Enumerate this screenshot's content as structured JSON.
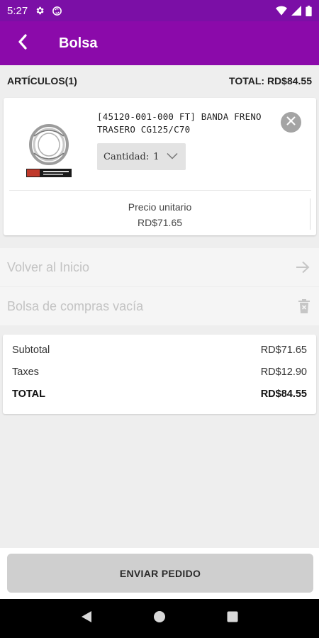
{
  "status_bar": {
    "time": "5:27",
    "icons": [
      "settings-icon",
      "sync-icon",
      "wifi-icon",
      "signal-icon",
      "battery-icon"
    ]
  },
  "app_bar": {
    "title": "Bolsa",
    "back_icon": "chevron-left-icon"
  },
  "summary": {
    "items_label": "ARTÍCULOS(1)",
    "total_label": "TOTAL: RD$84.55"
  },
  "cart": {
    "items": [
      {
        "name": "[45120-001-000 FT] BANDA FRENO TRASERO CG125/C70",
        "quantity_label": "Cantidad:",
        "quantity": "1",
        "unit_price_label": "Precio unitario",
        "unit_price": "RD$71.65"
      }
    ]
  },
  "actions": {
    "home_label": "Volver al Inicio",
    "empty_label": "Bolsa de compras vacía"
  },
  "totals": {
    "subtotal_label": "Subtotal",
    "subtotal_value": "RD$71.65",
    "taxes_label": "Taxes",
    "taxes_value": "RD$12.90",
    "total_label": "TOTAL",
    "total_value": "RD$84.55"
  },
  "submit": {
    "label": "ENVIAR PEDIDO"
  },
  "colors": {
    "primary": "#8b0aaa",
    "status_bar": "#7b0fa6",
    "background": "#eeeeee"
  }
}
